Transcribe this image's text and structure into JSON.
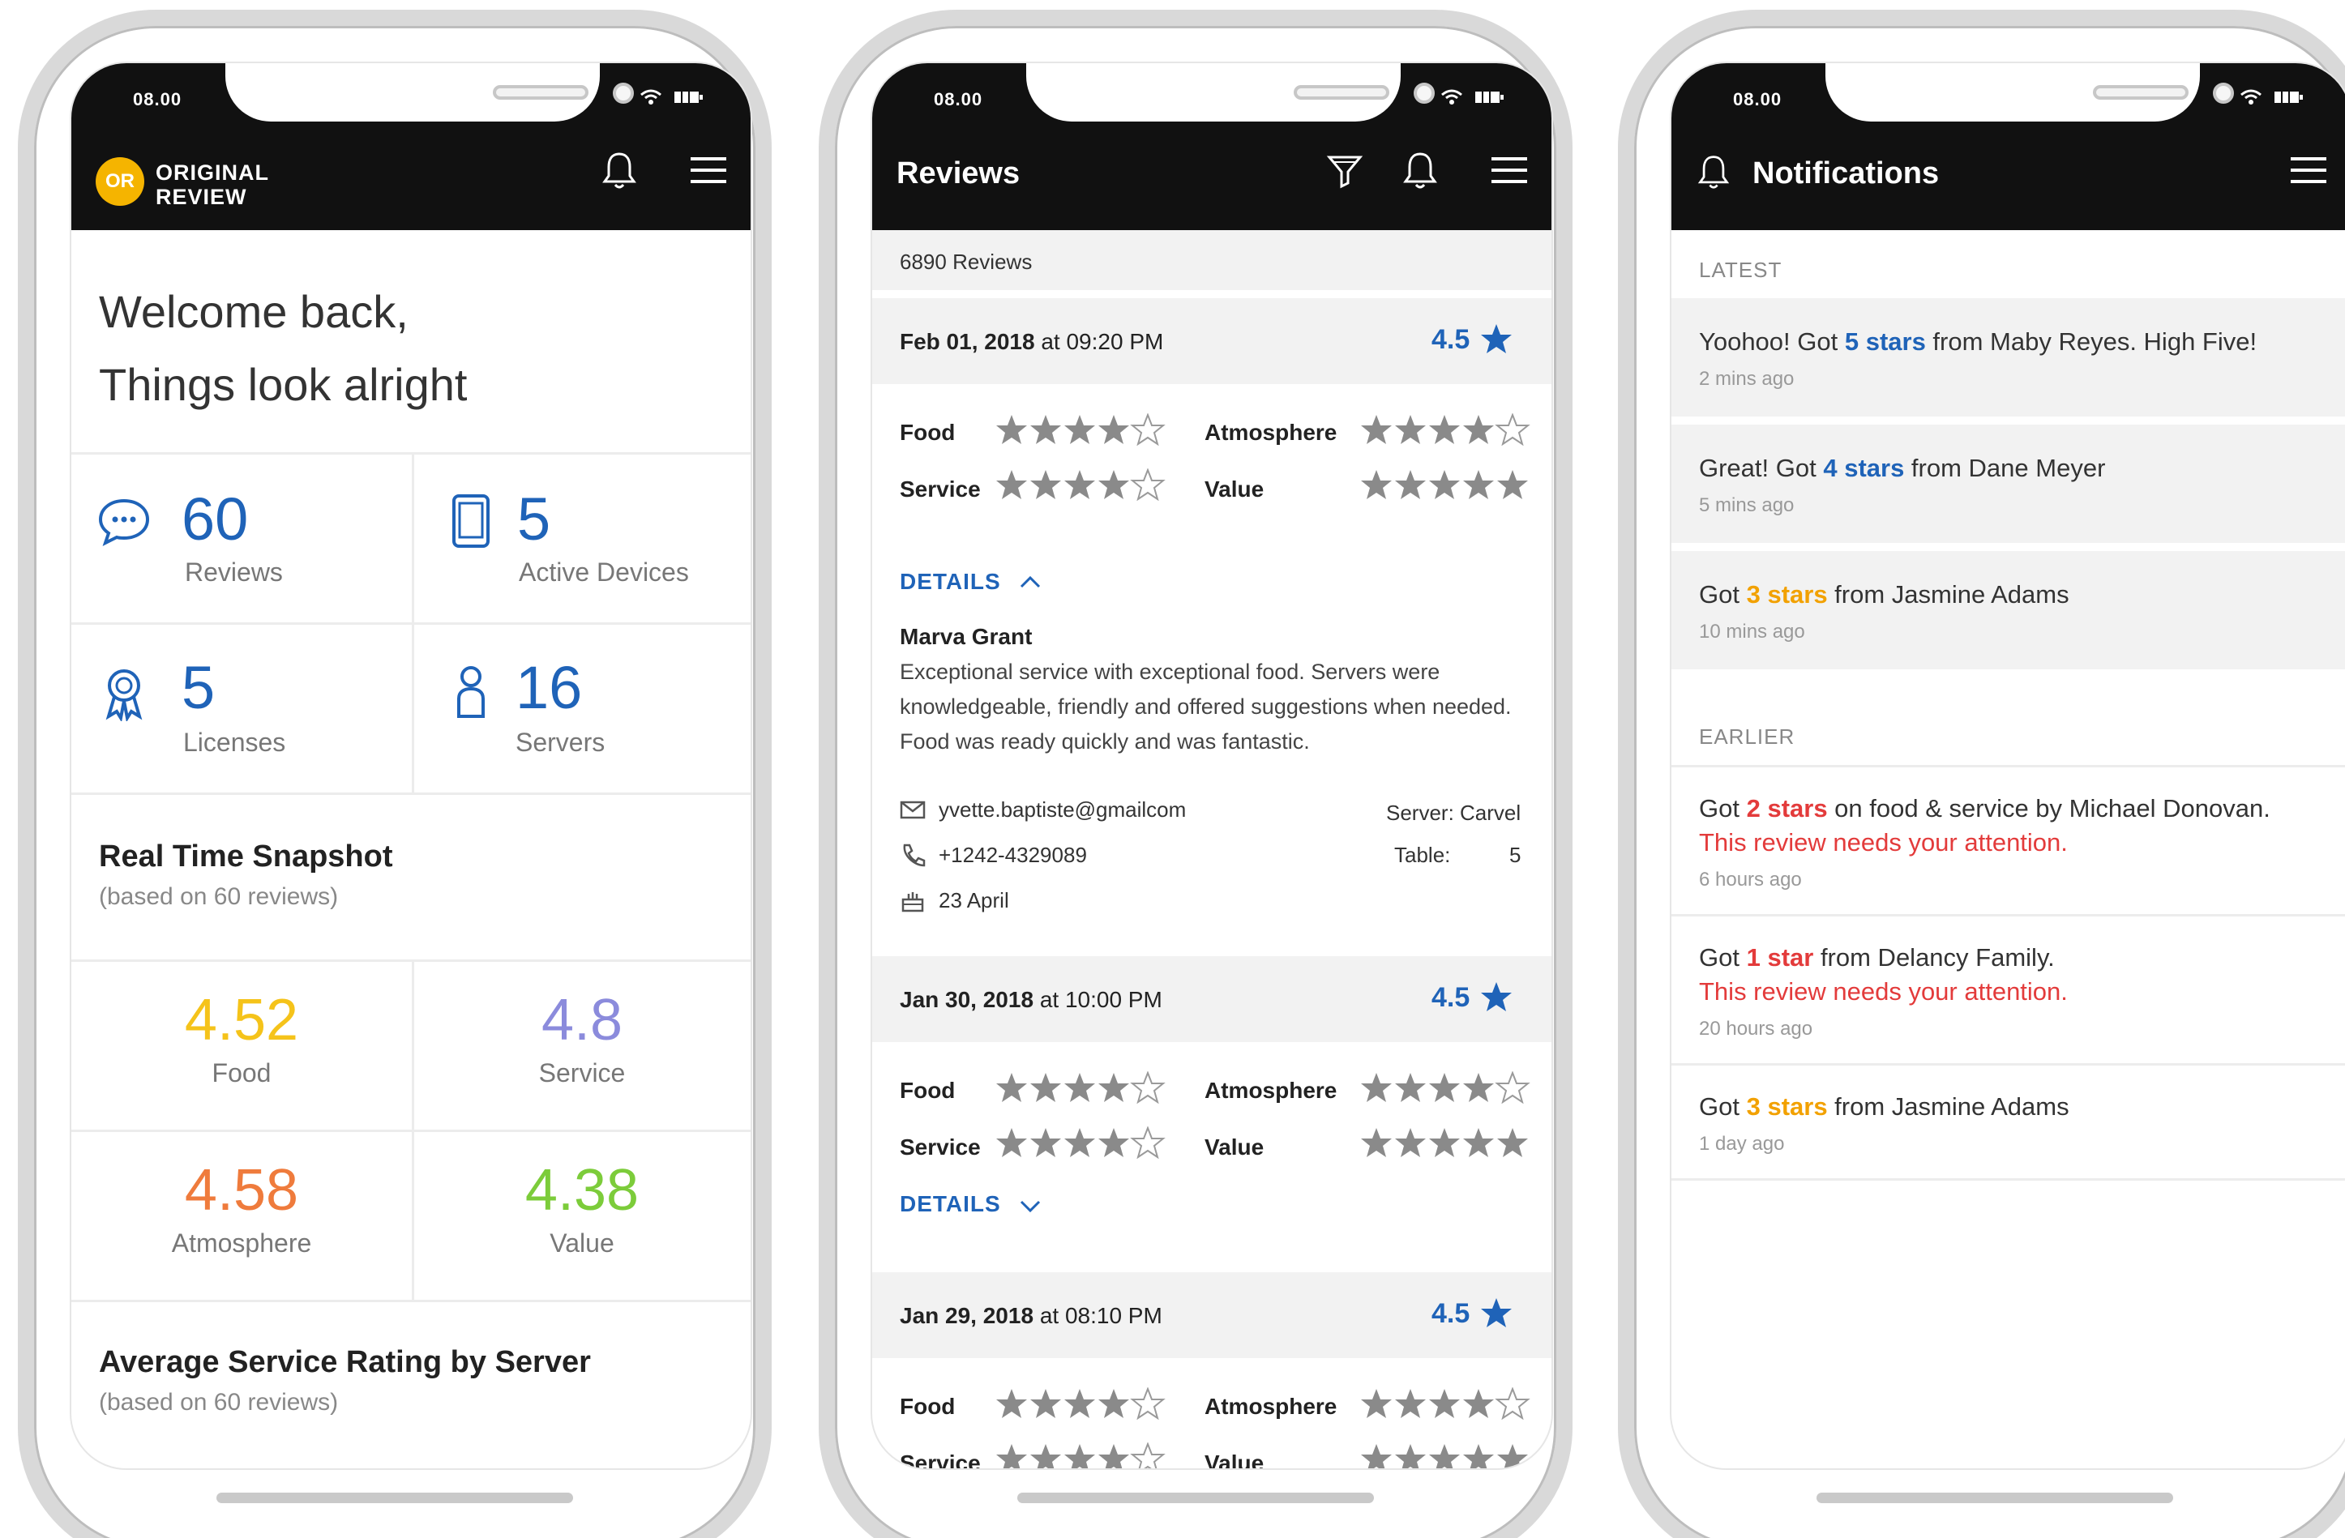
{
  "status_time": "08.00",
  "dashboard": {
    "logo_initials": "OR",
    "logo_line1": "ORIGINAL",
    "logo_line2": "REVIEW",
    "welcome_line1": "Welcome back,",
    "welcome_line2": "Things look alright",
    "stats": [
      {
        "value": "60",
        "label": "Reviews",
        "icon": "chat-bubble-icon"
      },
      {
        "value": "5",
        "label": "Active Devices",
        "icon": "tablet-icon"
      },
      {
        "value": "5",
        "label": "Licenses",
        "icon": "award-icon"
      },
      {
        "value": "16",
        "label": "Servers",
        "icon": "person-icon"
      }
    ],
    "snapshot_title": "Real Time Snapshot",
    "snapshot_sub": "(based on 60 reviews)",
    "ratings": [
      {
        "value": "4.52",
        "label": "Food",
        "color": "#f5c31a"
      },
      {
        "value": "4.8",
        "label": "Service",
        "color": "#8b8bdc"
      },
      {
        "value": "4.58",
        "label": "Atmosphere",
        "color": "#ef7b3c"
      },
      {
        "value": "4.38",
        "label": "Value",
        "color": "#7ccc3a"
      }
    ],
    "server_title": "Average Service Rating by Server",
    "server_sub": "(based on 60 reviews)"
  },
  "reviews": {
    "title": "Reviews",
    "count": "6890 Reviews",
    "categories": {
      "food": "Food",
      "atmosphere": "Atmosphere",
      "service": "Service",
      "value": "Value"
    },
    "details_label": "DETAILS",
    "items": [
      {
        "date": "Feb 01, 2018",
        "at": "at",
        "time": "09:20 PM",
        "score": "4.5",
        "food_stars": 4,
        "atmosphere_stars": 4,
        "service_stars": 4,
        "value_stars": 5,
        "expanded": true
      },
      {
        "date": "Jan 30, 2018",
        "at": "at",
        "time": "10:00 PM",
        "score": "4.5",
        "food_stars": 4,
        "atmosphere_stars": 4,
        "service_stars": 4,
        "value_stars": 5,
        "expanded": false
      },
      {
        "date": "Jan 29, 2018",
        "at": "at",
        "time": "08:10 PM",
        "score": "4.5",
        "food_stars": 4,
        "atmosphere_stars": 4,
        "service_stars": 4,
        "value_stars": 5,
        "expanded": false
      }
    ],
    "detail": {
      "name": "Marva Grant",
      "text": "Exceptional service with exceptional food. Servers were knowledgeable, friendly and offered suggestions when needed. Food was ready quickly and was fantastic.",
      "email": "yvette.baptiste@gmailcom",
      "phone": "+1242-4329089",
      "birthday": "23 April",
      "server_label": "Server: Carvel",
      "table_label": "Table:",
      "table_value": "5"
    }
  },
  "notifications": {
    "title": "Notifications",
    "latest_label": "LATEST",
    "earlier_label": "EARLIER",
    "latest": [
      {
        "pre": "Yoohoo! Got ",
        "hl": "5 stars",
        "post": " from Maby Reyes. High Five!",
        "time": "2 mins ago",
        "color": "blue"
      },
      {
        "pre": "Great! Got ",
        "hl": "4 stars",
        "post": " from Dane Meyer",
        "time": "5 mins ago",
        "color": "blue"
      },
      {
        "pre": "Got ",
        "hl": "3 stars",
        "post": " from Jasmine Adams",
        "time": "10 mins ago",
        "color": "orange"
      }
    ],
    "earlier": [
      {
        "pre": "Got ",
        "hl": "2 stars",
        "post": " on food & service by Michael Donovan.",
        "alert": "This review needs your attention.",
        "time": "6 hours ago",
        "color": "red"
      },
      {
        "pre": "Got ",
        "hl": "1 star",
        "post": " from Delancy Family.",
        "alert": "This review needs your attention.",
        "time": "20 hours ago",
        "color": "red"
      },
      {
        "pre": "Got ",
        "hl": "3 stars",
        "post": " from Jasmine Adams",
        "time": "1 day ago",
        "color": "orange"
      }
    ]
  }
}
